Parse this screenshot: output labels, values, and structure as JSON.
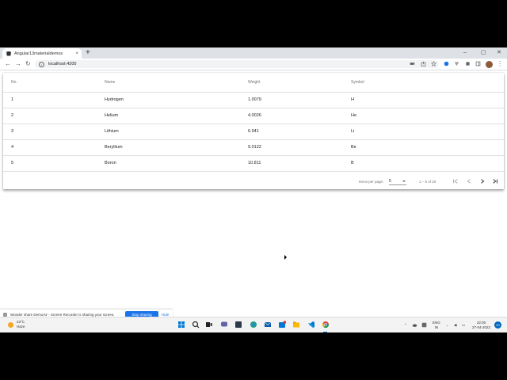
{
  "browser": {
    "tab_title": "Angular13materialdemos",
    "tab_close": "×",
    "new_tab": "+",
    "url": "localhost:4200",
    "window_controls": {
      "minimize": "–",
      "maximize": "▢",
      "close": "✕"
    }
  },
  "table": {
    "headers": {
      "no": "No.",
      "name": "Name",
      "weight": "Weight",
      "symbol": "Symbol"
    },
    "rows": [
      {
        "no": "1",
        "name": "Hydrogen",
        "weight": "1.0079",
        "symbol": "H"
      },
      {
        "no": "2",
        "name": "Helium",
        "weight": "4.0026",
        "symbol": "He"
      },
      {
        "no": "3",
        "name": "Lithium",
        "weight": "6.941",
        "symbol": "Li"
      },
      {
        "no": "4",
        "name": "Beryllium",
        "weight": "9.0122",
        "symbol": "Be"
      },
      {
        "no": "5",
        "name": "Boron",
        "weight": "10.811",
        "symbol": "B"
      }
    ]
  },
  "paginator": {
    "items_per_page_label": "Items per page:",
    "page_size": "5",
    "range_label": "1 – 5 of 20"
  },
  "share_bar": {
    "message": "Wonder share DemoAir - Screen Recorder is sharing your screen.",
    "stop_label": "Stop sharing",
    "hide_label": "Hide"
  },
  "taskbar": {
    "weather_temp": "23°C",
    "weather_desc": "Haze",
    "language": "ENG",
    "region": "IN",
    "time": "22:00",
    "date": "27-04-2022",
    "notifications": "20",
    "store_badge": "3"
  },
  "colors": {
    "accent": "#1a73e8",
    "taskbar": "#f3f3f3",
    "chrome_tabstrip": "#dee1e6"
  }
}
